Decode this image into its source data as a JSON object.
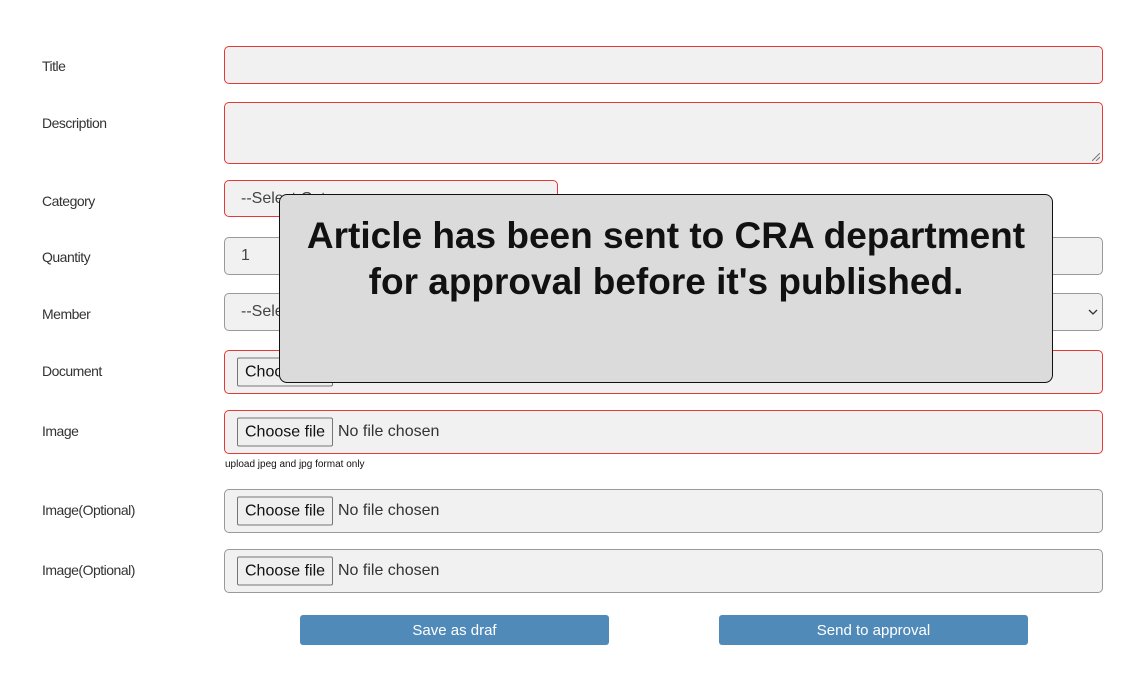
{
  "form": {
    "title_label": "Title",
    "title_value": "",
    "description_label": "Description",
    "description_value": "",
    "category_label": "Category",
    "category_value": "--Select Category--",
    "quantity_label": "Quantity",
    "quantity_value": "1",
    "member_label": "Member",
    "member_value": "--Select Member--",
    "document_label": "Document",
    "image_label": "Image",
    "image_hint": "upload jpeg and jpg format only",
    "image_optional_1_label": "Image(Optional)",
    "image_optional_2_label": "Image(Optional)",
    "choose_file_label": "Choose file",
    "no_file_text": "No file chosen"
  },
  "actions": {
    "save_draft_label": "Save as draf",
    "send_approval_label": "Send to approval"
  },
  "modal": {
    "message": "Article has been sent to  CRA  department for approval before it's published."
  },
  "colors": {
    "invalid_border": "#e53935",
    "button_bg": "#508ab9",
    "modal_bg": "#dcdbdb"
  }
}
